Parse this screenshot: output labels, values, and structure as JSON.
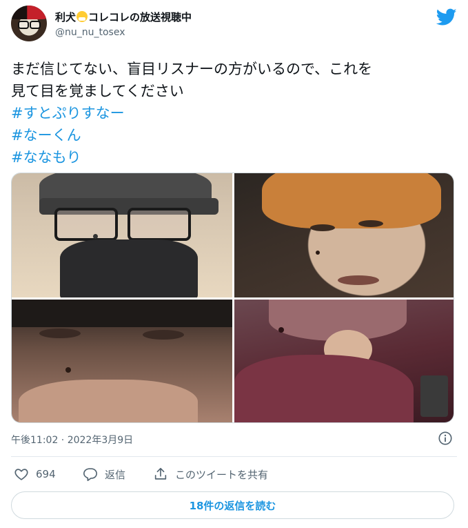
{
  "author": {
    "display_name_part1": "利犬",
    "display_name_emoji": "face-with-medical-mask",
    "display_name_part2": "コレコレの放送視聴中",
    "username": "@nu_nu_tosex"
  },
  "tweet": {
    "line1": "まだ信じてない、盲目リスナーの方がいるので、これを",
    "line2": "見て目を覚ましてください",
    "hashtags": [
      "#すとぷりすなー",
      "#なーくん",
      "#ななもり"
    ]
  },
  "media": {
    "photo_count": 4
  },
  "meta": {
    "timestamp": "午後11:02 · 2022年3月9日"
  },
  "actions": {
    "like_count": "694",
    "reply_label": "返信",
    "share_label": "このツイートを共有"
  },
  "replies_button": {
    "label": "18件の返信を読む"
  },
  "colors": {
    "accent": "#1b95e0",
    "twitter_blue": "#1d9bf0",
    "secondary_text": "#536471",
    "border": "#cfd9de"
  }
}
